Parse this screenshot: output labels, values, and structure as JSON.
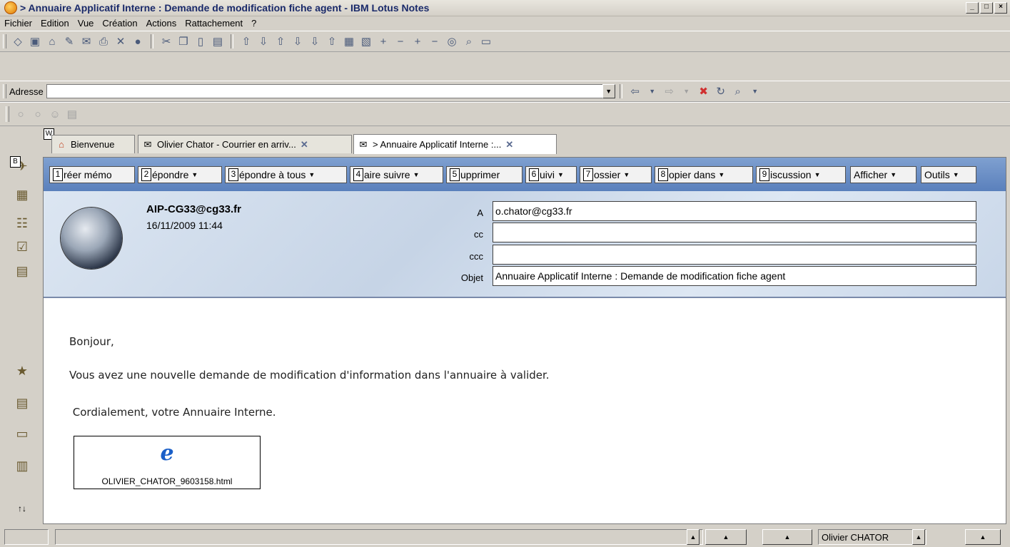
{
  "window": {
    "title": "> Annuaire Applicatif Interne : Demande de modification fiche agent - IBM Lotus Notes"
  },
  "menu": [
    "Fichier",
    "Edition",
    "Vue",
    "Création",
    "Actions",
    "Rattachement",
    "?"
  ],
  "address": {
    "label": "Adresse",
    "value": ""
  },
  "tabs": [
    {
      "label": "Bienvenue"
    },
    {
      "label": "Olivier Chator - Courrier en arriv..."
    },
    {
      "label": "> Annuaire Applicatif Interne :..."
    }
  ],
  "badges": {
    "w": "W",
    "b": "B"
  },
  "actions": [
    {
      "num": "1",
      "label": "réer mémo",
      "caret": false
    },
    {
      "num": "2",
      "label": "épondre",
      "caret": true
    },
    {
      "num": "3",
      "label": "épondre à tous",
      "caret": true
    },
    {
      "num": "4",
      "label": "aire suivre",
      "caret": true
    },
    {
      "num": "5",
      "label": "upprimer",
      "caret": false
    },
    {
      "num": "6",
      "label": "uivi",
      "caret": true
    },
    {
      "num": "7",
      "label": "ossier",
      "caret": true
    },
    {
      "num": "8",
      "label": "opier dans",
      "caret": true
    },
    {
      "num": "9",
      "label": "iscussion",
      "caret": true
    },
    {
      "num": "",
      "label": "Afficher",
      "caret": true
    },
    {
      "num": "",
      "label": "Outils",
      "caret": true
    }
  ],
  "message": {
    "sender": "AIP-CG33@cg33.fr",
    "date": "16/11/2009 11:44",
    "fields": [
      {
        "label": "A",
        "value": "o.chator@cg33.fr"
      },
      {
        "label": "cc",
        "value": ""
      },
      {
        "label": "ccc",
        "value": ""
      },
      {
        "label": "Objet",
        "value": "Annuaire Applicatif Interne : Demande de modification fiche agent"
      }
    ],
    "body": [
      "Bonjour,",
      "Vous avez une nouvelle demande de modification d'information dans l'annuaire à valider.",
      " Cordialement, votre Annuaire Interne."
    ],
    "attachment": "OLIVIER_CHATOR_9603158.html"
  },
  "status": {
    "user": "Olivier CHATOR"
  }
}
